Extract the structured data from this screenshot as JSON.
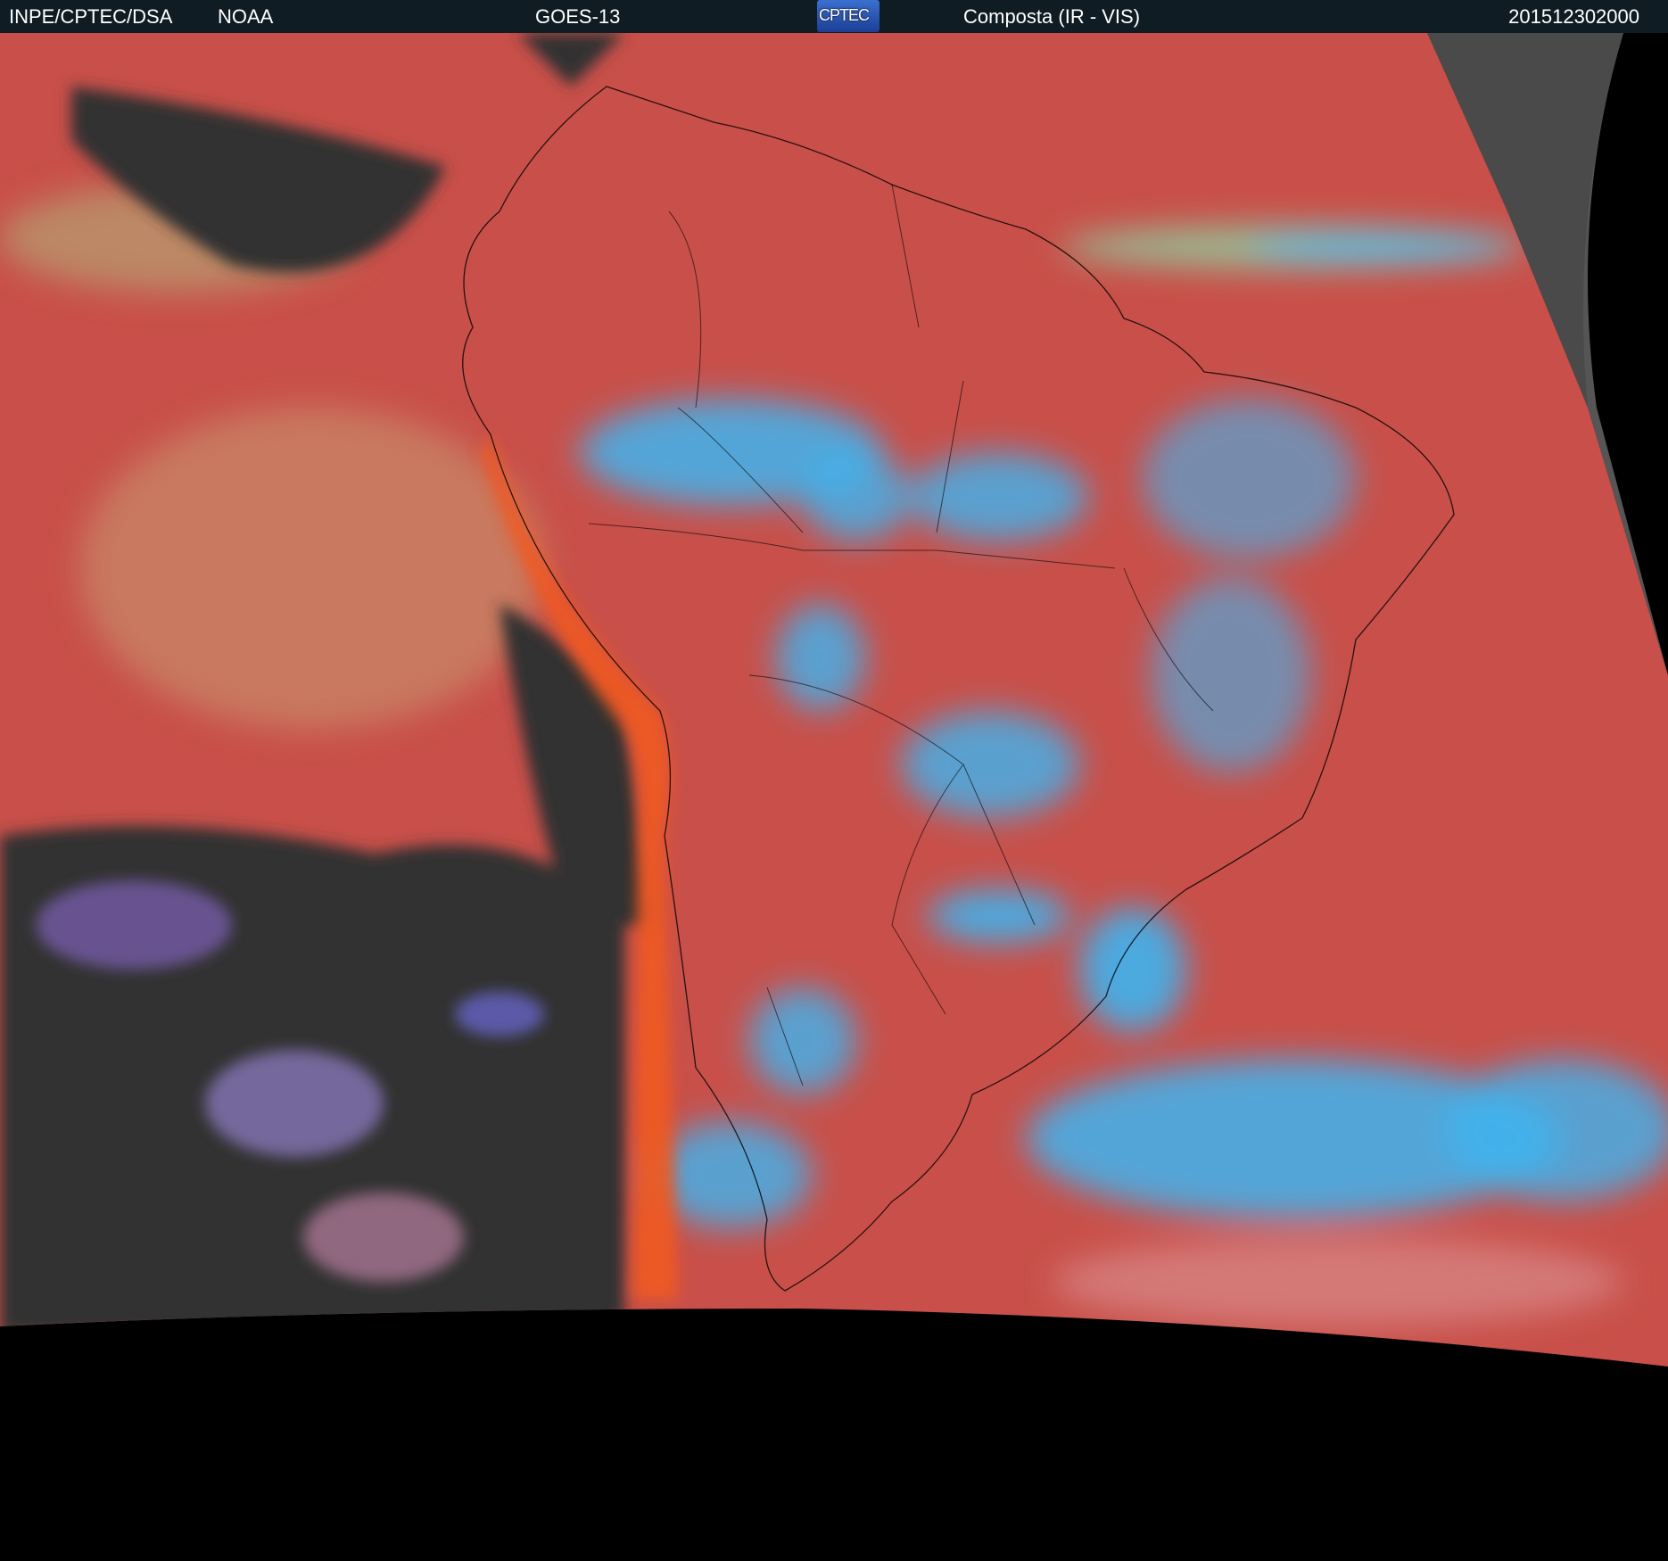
{
  "header": {
    "agency": "INPE/CPTEC/DSA",
    "partner": "NOAA",
    "satellite": "GOES-13",
    "logo_text": "CPTEC",
    "product": "Composta (IR - VIS)",
    "timestamp": "201512302000"
  },
  "colors": {
    "header_bg": "#101c24",
    "ocean_base": "#c9504a",
    "high_cloud": "#3fb4f0",
    "clear_sky": "#333333",
    "coastal_orange": "#f05a20"
  }
}
